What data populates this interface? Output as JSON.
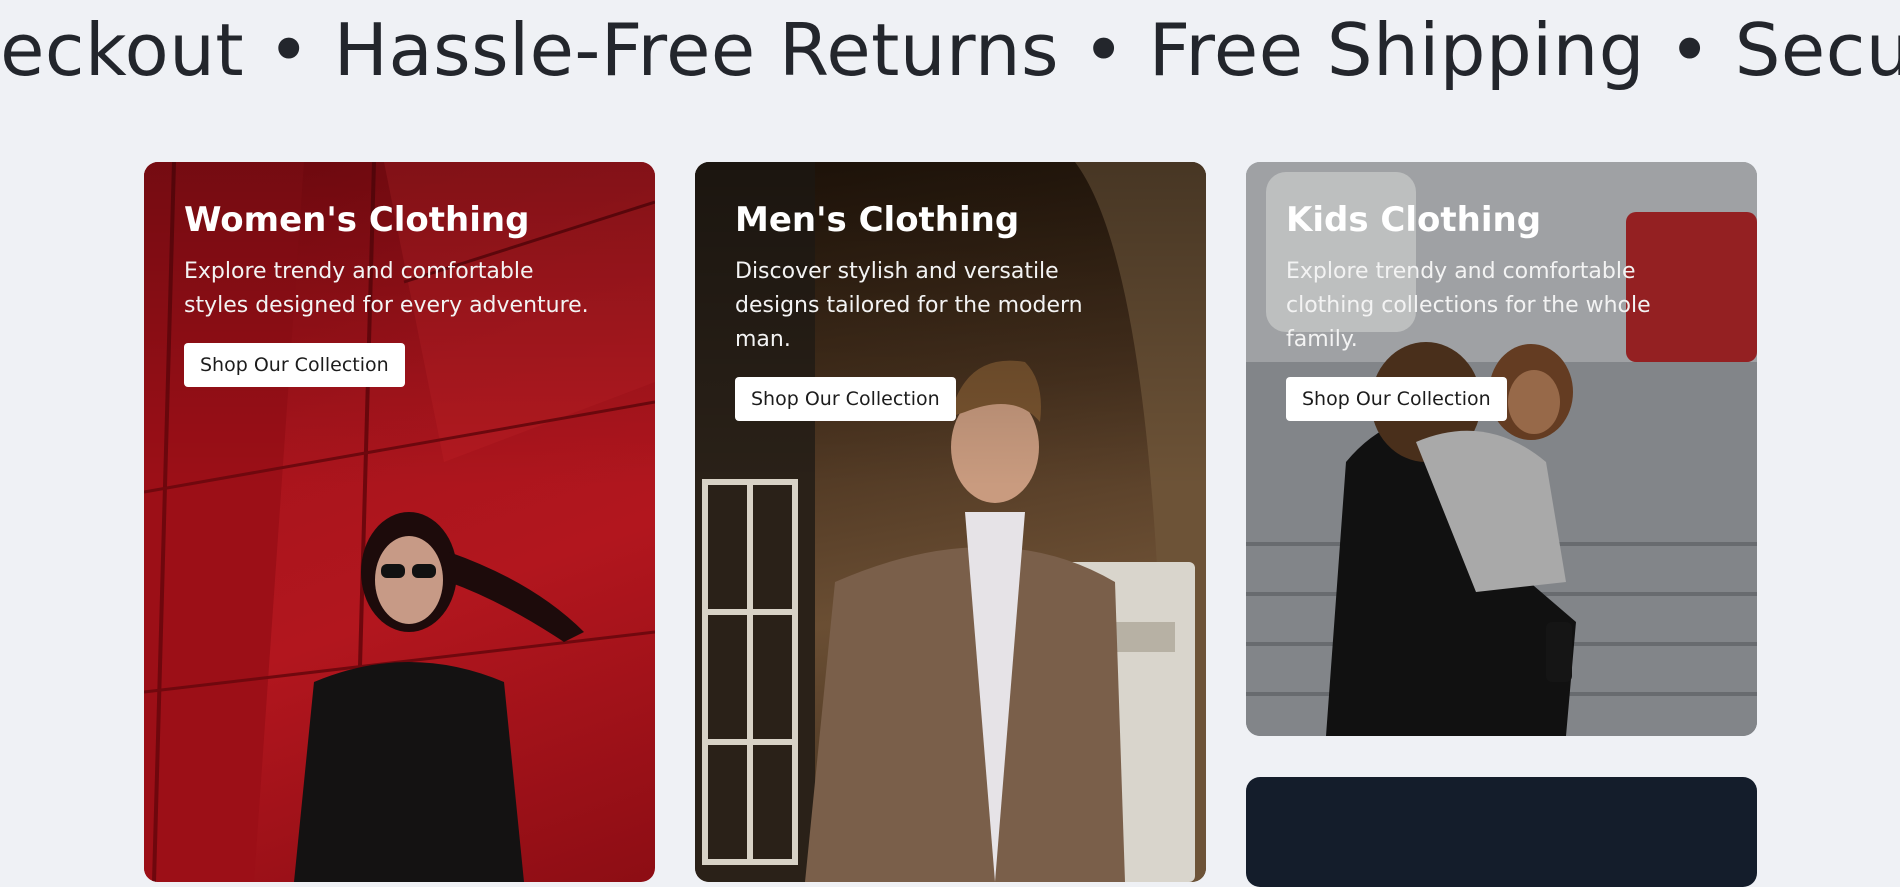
{
  "marquee": {
    "text": "heckout • Hassle-Free Returns • Free Shipping • Secur"
  },
  "categories": [
    {
      "title": "Women's Clothing",
      "description": "Explore trendy and comfortable styles designed for every adventure.",
      "button_label": "Shop Our Collection"
    },
    {
      "title": "Men's Clothing",
      "description": "Discover stylish and versatile designs tailored for the modern man.",
      "button_label": "Shop Our Collection"
    },
    {
      "title": "Kids Clothing",
      "description": "Explore trendy and comfortable clothing collections for the whole family.",
      "button_label": "Shop Our Collection"
    }
  ],
  "colors": {
    "page_background": "#eff1f5",
    "marquee_text": "#23262c",
    "women_card": "#a8141c",
    "men_card": "#4b3420",
    "kids_card": "#b3b7bc",
    "dark_card": "#141d2b",
    "button_bg": "#ffffff"
  }
}
